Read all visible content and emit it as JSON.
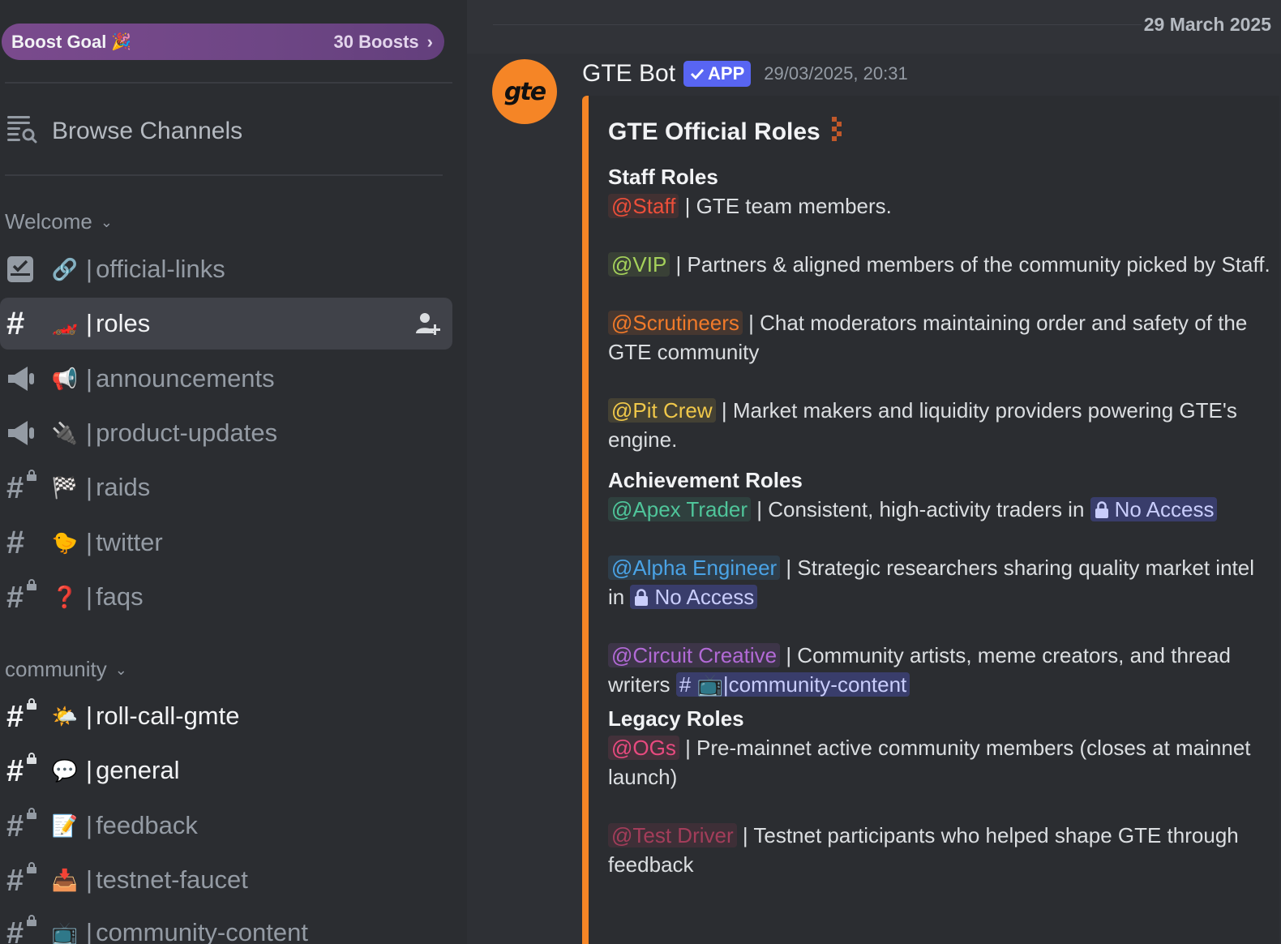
{
  "sidebar": {
    "boost": {
      "label": "Boost Goal",
      "emoji": "🎉",
      "count": "30 Boosts",
      "chevron": "›"
    },
    "browse": "Browse Channels",
    "categories": [
      {
        "label": "Welcome"
      },
      {
        "label": "community"
      }
    ],
    "channels": [
      {
        "emoji": "🔗",
        "name": "official-links",
        "icon": "rules-checkbox-icon"
      },
      {
        "emoji": "🏎️",
        "name": "roles",
        "icon": "hash-icon",
        "active": true
      },
      {
        "emoji": "📢",
        "name": "announcements",
        "icon": "megaphone-icon"
      },
      {
        "emoji": "🔌",
        "name": "product-updates",
        "icon": "megaphone-icon"
      },
      {
        "emoji": "🏁",
        "name": "raids",
        "icon": "locked-hash-icon"
      },
      {
        "emoji": "🐤",
        "name": "twitter",
        "icon": "hash-icon"
      },
      {
        "emoji": "❓",
        "name": "faqs",
        "icon": "locked-hash-icon"
      },
      {
        "emoji": "🌤️",
        "name": "roll-call-gmte",
        "icon": "locked-hash-icon",
        "unread": true
      },
      {
        "emoji": "💬",
        "name": "general",
        "icon": "locked-hash-icon",
        "unread": true
      },
      {
        "emoji": "📝",
        "name": "feedback",
        "icon": "locked-hash-icon"
      },
      {
        "emoji": "📥",
        "name": "testnet-faucet",
        "icon": "locked-hash-icon"
      },
      {
        "emoji": "📺",
        "name": "community-content",
        "icon": "locked-hash-icon"
      }
    ],
    "separator": "|"
  },
  "main": {
    "date": "29 March 2025",
    "message": {
      "author": "GTE Bot",
      "avatar_text": "gte",
      "tag": "APP",
      "timestamp": "29/03/2025, 20:31",
      "embed": {
        "title": "GTE Official Roles",
        "sections": {
          "staff": "Staff Roles",
          "achievement": "Achievement Roles",
          "legacy": "Legacy Roles"
        },
        "roles": {
          "staff": {
            "mention": "@Staff",
            "text": " | GTE team members."
          },
          "vip": {
            "mention": "@VIP",
            "text": " | Partners & aligned members of the community picked by Staff."
          },
          "scrut": {
            "mention": "@Scrutineers",
            "text": " | Chat moderators maintaining order and safety of the GTE community"
          },
          "pit": {
            "mention": "@Pit Crew",
            "text": " | Market makers and liquidity providers powering GTE's engine."
          },
          "apex": {
            "mention": "@Apex Trader",
            "text": " | Consistent, high-activity traders in ",
            "link": "No Access"
          },
          "alpha": {
            "mention": "@Alpha Engineer",
            "text": " | Strategic researchers sharing quality market intel in ",
            "link": "No Access"
          },
          "circuit": {
            "mention": "@Circuit Creative",
            "text": " | Community artists, meme creators, and thread writers ",
            "link_hash": "#",
            "link_emoji": "📺",
            "link": "|community-content"
          },
          "og": {
            "mention": "@OGs",
            "text": " | Pre-mainnet active community members (closes at mainnet launch)"
          },
          "test": {
            "mention": "@Test Driver",
            "text": " | Testnet participants who helped shape GTE through feedback"
          }
        }
      }
    }
  },
  "colors": {
    "accent_embed": "#f58526",
    "app_tag": "#5865f2",
    "boost_purple": "#7a4a8d"
  }
}
